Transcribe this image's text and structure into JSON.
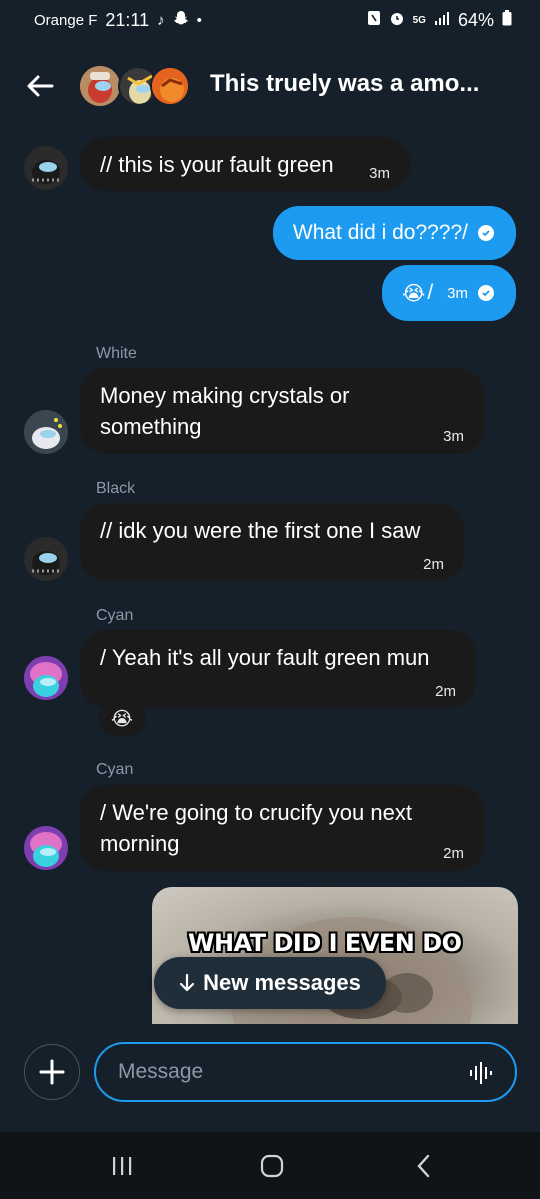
{
  "status_bar": {
    "carrier": "Orange F",
    "time": "21:11",
    "network": "5G",
    "battery": "64%"
  },
  "header": {
    "title": "This truely was a amo..."
  },
  "messages": [
    {
      "type": "in",
      "text": "// this is your fault green",
      "time": "3m"
    },
    {
      "type": "out",
      "text": "What did i do????/"
    },
    {
      "type": "out",
      "emoji": "😭",
      "text": "/",
      "time": "3m"
    },
    {
      "type": "in",
      "sender": "White",
      "text": "Money making crystals or something",
      "time": "3m"
    },
    {
      "type": "in",
      "sender": "Black",
      "text": "// idk you were the first one I saw",
      "time": "2m"
    },
    {
      "type": "in",
      "sender": "Cyan",
      "text": "/  Yeah it's all your fault green mun",
      "time": "2m",
      "reaction": "😭"
    },
    {
      "type": "in",
      "sender": "Cyan",
      "text": "/  We're going to crucify you next morning",
      "time": "2m"
    }
  ],
  "image_message": {
    "caption": "WHAT DID I EVEN DO"
  },
  "new_messages_pill": {
    "label": "New messages"
  },
  "composer": {
    "placeholder": "Message"
  },
  "colors": {
    "background": "#15202b",
    "bubble_in": "#1a1a1a",
    "bubble_out": "#1d9bf0",
    "secondary_text": "#8b98a5"
  },
  "icons": {
    "back": "arrow-left-icon",
    "add": "plus-icon",
    "voice": "audio-wave-icon",
    "nav_recents": "recents-icon",
    "nav_home": "home-icon",
    "nav_back": "chevron-left-icon"
  }
}
